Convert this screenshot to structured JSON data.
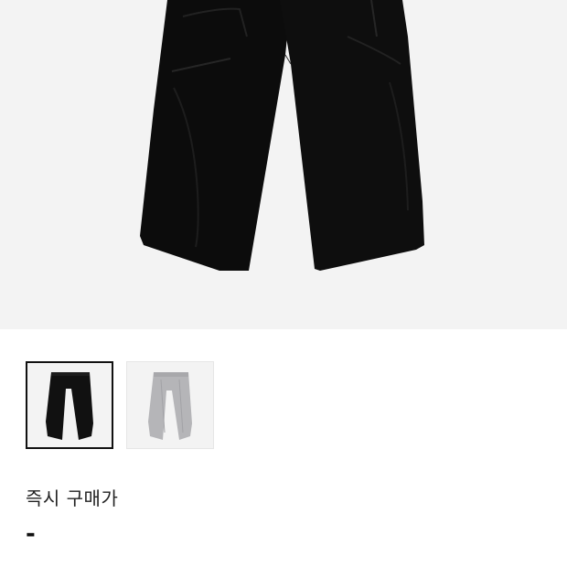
{
  "product": {
    "main_image_icon": "black-pants-photo",
    "thumbnails": [
      {
        "name": "black-pants-thumb",
        "color": "#111111",
        "selected": true
      },
      {
        "name": "gray-pants-thumb",
        "color": "#b5b5b8",
        "selected": false
      }
    ]
  },
  "price": {
    "label": "즉시 구매가",
    "value": "-"
  },
  "colors": {
    "background": "#f3f3f3",
    "selected_border": "#111111"
  }
}
